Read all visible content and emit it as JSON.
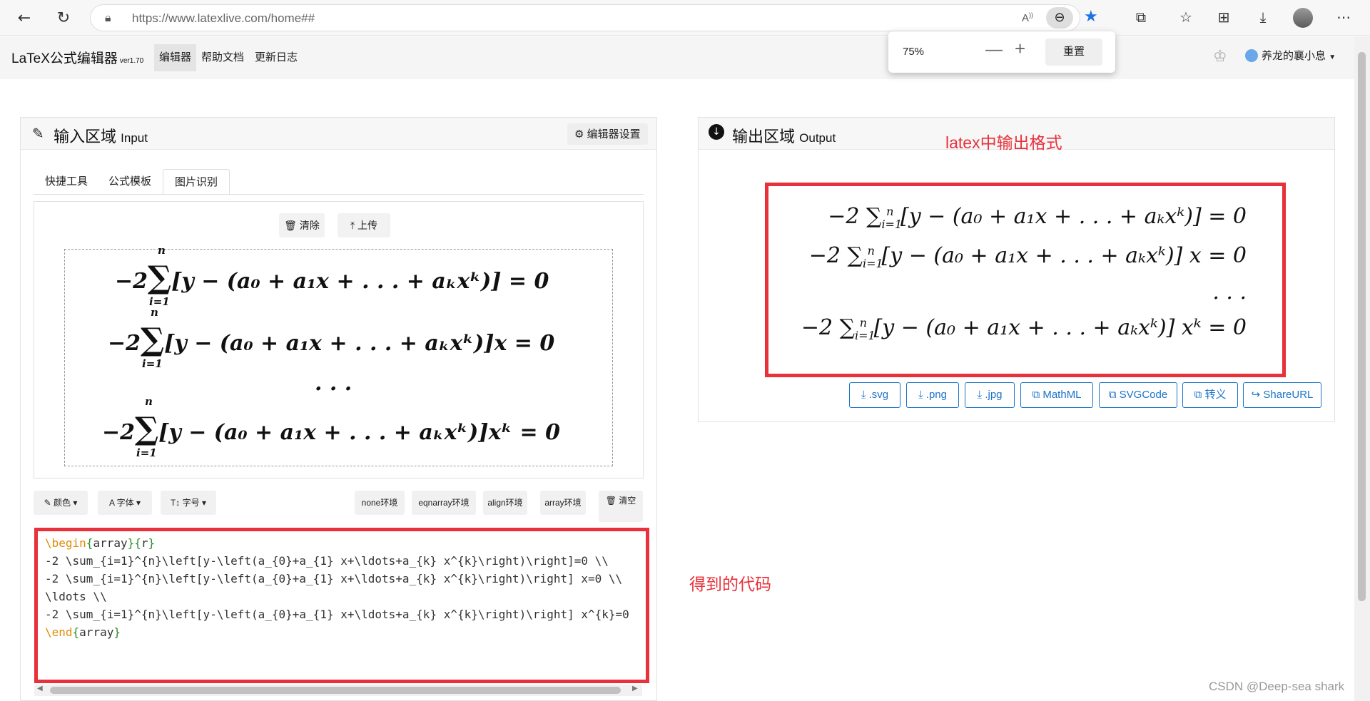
{
  "browser": {
    "url": "https://www.latexlive.com/home##",
    "zoom_level": "75%",
    "zoom_reset_label": "重置"
  },
  "app": {
    "brand": "LaTeX公式编辑器",
    "version": "ver1.70",
    "nav": [
      "编辑器",
      "帮助文档",
      "更新日志"
    ],
    "user_name": "养龙的襄小息"
  },
  "input_panel": {
    "title_cn": "输入区域",
    "title_en": "Input",
    "settings_label": "编辑器设置",
    "tabs": [
      "快捷工具",
      "公式模板",
      "图片识别"
    ],
    "active_tab": "图片识别",
    "clear_label": "清除",
    "upload_label": "上传",
    "toolbar": {
      "left": [
        "颜色",
        "字体",
        "字号"
      ],
      "env_buttons": [
        "none环境",
        "eqnarray环境",
        "align环境",
        "array环境"
      ],
      "clear_all_label": "清空"
    }
  },
  "output_panel": {
    "title_cn": "输出区域",
    "title_en": "Output",
    "annotation": "latex中输出格式",
    "download_buttons": [
      ".svg",
      ".png",
      ".jpg",
      "MathML",
      "SVGCode",
      "转义",
      "ShareURL"
    ]
  },
  "code_annotation": "得到的代码",
  "code_lines": [
    "\\begin{array}{r}",
    "-2 \\sum_{i=1}^{n}\\left[y-\\left(a_{0}+a_{1} x+\\ldots+a_{k} x^{k}\\right)\\right]=0 \\\\",
    "-2 \\sum_{i=1}^{n}\\left[y-\\left(a_{0}+a_{1} x+\\ldots+a_{k} x^{k}\\right)\\right] x=0 \\\\",
    "\\ldots \\\\",
    "-2 \\sum_{i=1}^{n}\\left[y-\\left(a_{0}+a_{1} x+\\ldots+a_{k} x^{k}\\right)\\right] x^{k}=0",
    "\\end{array}"
  ],
  "watermark": "CSDN @Deep-sea shark",
  "colors": {
    "accent_blue": "#1a73c8",
    "annotation_red": "#e8313a"
  },
  "icons": [
    "back-icon",
    "refresh-icon",
    "lock-icon",
    "read-aloud-icon",
    "zoom-out-icon",
    "star-icon",
    "extensions-icon",
    "favorites-icon",
    "collections-icon",
    "download-icon",
    "profile-avatar",
    "more-icon",
    "edit-icon",
    "gear-icon",
    "download-circle-icon",
    "trash-icon",
    "upload-icon"
  ]
}
